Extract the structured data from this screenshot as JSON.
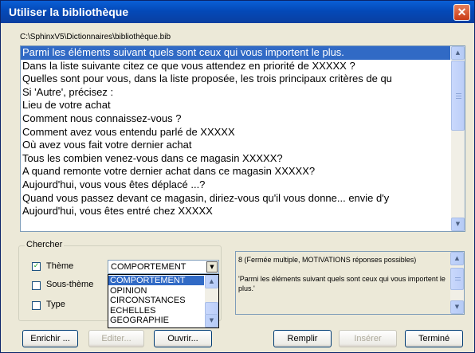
{
  "window": {
    "title": "Utiliser la bibliothèque"
  },
  "path": "C:\\SphinxV5\\Dictionnaires\\bibliothèque.bib",
  "questions": [
    "Parmi les éléments suivant quels sont ceux qui vous importent le plus.",
    "Dans la liste suivante citez ce que vous attendez en priorité de XXXXX ?",
    "Quelles sont pour vous, dans la liste proposée, les trois principaux critères de qu",
    "Si 'Autre', précisez :",
    "Lieu de votre achat",
    "Comment nous connaissez-vous ?",
    "Comment avez vous entendu parlé de XXXXX",
    "Où avez vous fait votre dernier achat",
    "Tous les combien venez-vous dans ce magasin XXXXX?",
    "A quand remonte votre dernier achat dans ce magasin XXXXX?",
    "Aujourd'hui, vous vous êtes déplacé ...?",
    "Quand vous passez devant ce magasin, diriez-vous qu'il vous donne... envie d'y",
    "Aujourd'hui, vous êtes entré chez XXXXX"
  ],
  "search": {
    "legend": "Chercher",
    "theme": {
      "label": "Thème",
      "checked": true
    },
    "subtheme": {
      "label": "Sous-thème",
      "checked": false
    },
    "type": {
      "label": "Type",
      "checked": false
    },
    "selected_theme": "COMPORTEMENT",
    "theme_options": [
      "COMPORTEMENT",
      "OPINION",
      "CIRCONSTANCES",
      "ECHELLES",
      "GEOGRAPHIE"
    ]
  },
  "info": {
    "text": "8 (Fermée multiple, MOTIVATIONS réponses possibles)\n\n'Parmi les éléments suivant quels sont ceux qui vous importent le plus.'"
  },
  "buttons": {
    "enrichir": "Enrichir ...",
    "editer": "Editer...",
    "ouvrir": "Ouvrir...",
    "remplir": "Remplir",
    "inserer": "Insérer",
    "termine": "Terminé"
  },
  "colors": {
    "selection": "#316ac5",
    "titlebar": "#0449b8",
    "face": "#ece9d8"
  }
}
